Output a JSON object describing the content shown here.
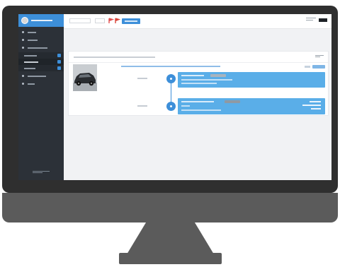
{
  "colors": {
    "accent": "#3d8fd9",
    "sidebar": "#2c3138",
    "monitor": "#2f2f2f",
    "stand": "#5b5b5b",
    "timeline_card": "#5aaee8"
  },
  "icons": {
    "topbar": [
      "flag-icon",
      "flag-icon"
    ],
    "timeline": [
      "timeline-node-icon",
      "timeline-node-icon"
    ]
  }
}
